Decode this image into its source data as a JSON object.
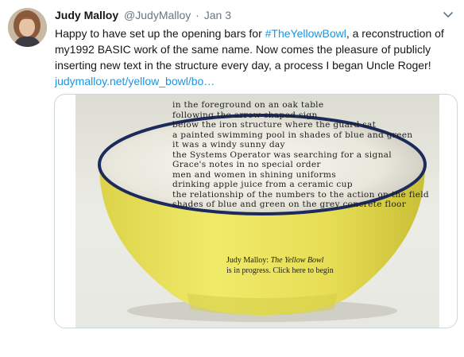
{
  "tweet": {
    "author": {
      "display_name": "Judy Malloy",
      "handle": "@JudyMalloy",
      "separator": "·",
      "timestamp": "Jan 3"
    },
    "body": {
      "part1": "Happy to have set up the opening bars for ",
      "hashtag": "#TheYellowBowl",
      "part2": ", a reconstruction of my1992 BASIC work of the same name.  Now comes the pleasure of publicly inserting new text in the structure every day, a process I began Uncle Roger!",
      "link": "judymalloy.net/yellow_bowl/bo…"
    },
    "menu_icon": "chevron-down-icon"
  },
  "card": {
    "poem_lines": [
      "in the foreground on an oak table",
      "following the arrow-shaped sign",
      "below the iron structure where the guard sat",
      "a painted swimming pool in shades of blue and green",
      "it was a windy sunny day",
      "the Systems Operator was searching for a signal",
      "Grace's notes in no special order",
      "men and women in shining uniforms",
      "drinking apple juice from a ceramic cup",
      "the relationship of the numbers to the action on the field",
      "shades of blue and green on the grey concrete floor"
    ],
    "caption": {
      "author": "Judy Malloy: ",
      "title": "The Yellow Bowl",
      "line2": "is in progress. Click here to begin"
    },
    "colors": {
      "bowl_yellow": "#eae25a",
      "bowl_rim": "#1c2a5c",
      "background": "#e6e6df"
    }
  }
}
